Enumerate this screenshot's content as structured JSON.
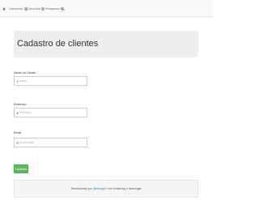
{
  "navbar": {
    "home_icon": "home-icon",
    "items": [
      {
        "label": "Cadastrar",
        "icon": "list-icon"
      },
      {
        "label": "Consultar",
        "icon": "list-icon"
      },
      {
        "label": "Pesquisar",
        "icon": "search-icon"
      }
    ],
    "refresh_icon": "refresh-icon"
  },
  "header": {
    "title": "Cadastro de clientes"
  },
  "form": {
    "name": {
      "label": "Nome do Cliente:",
      "placeholder": "Nome",
      "icon": "user-icon"
    },
    "address": {
      "label": "Endereço:",
      "placeholder": "Endereço",
      "icon": "home-icon"
    },
    "email": {
      "label": "Email:",
      "placeholder": "Email válido",
      "icon": "envelope-icon"
    },
    "submit_label": "Cadastrar"
  },
  "footer": {
    "prefix": "Desenvolvido por",
    "link": "@bertoglio",
    "suffix": "Luiz Armstrong e tecnologia"
  },
  "colors": {
    "accent_green": "#5cb85c",
    "navbar_bg": "#f8f8f8",
    "jumbotron_bg": "#eeeeee"
  }
}
